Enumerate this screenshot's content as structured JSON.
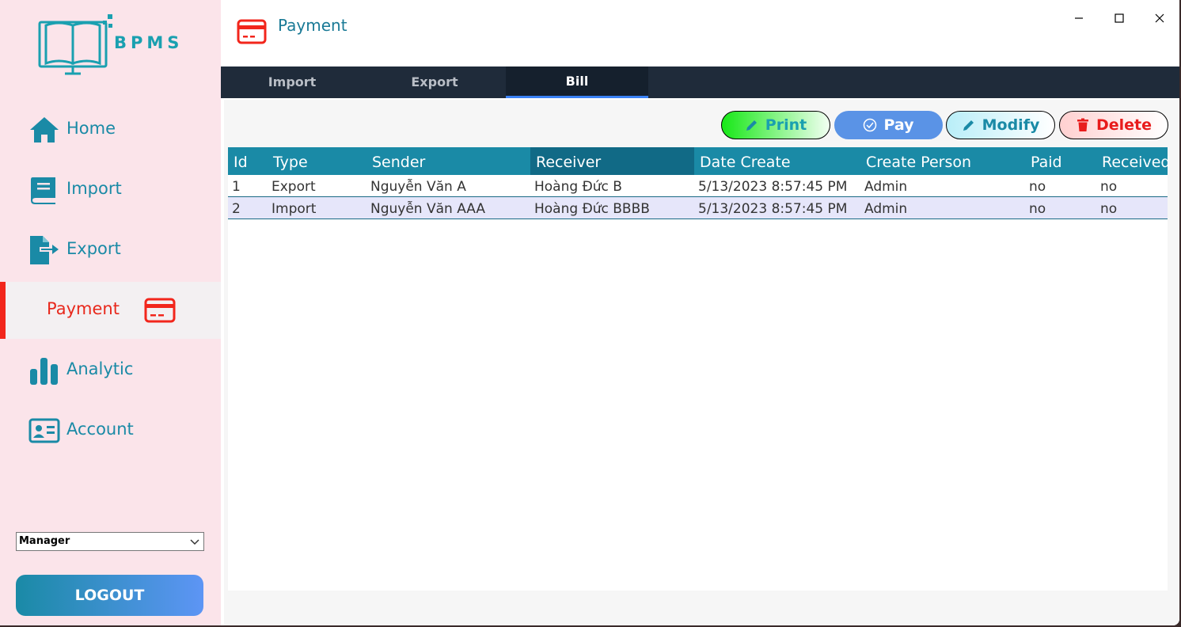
{
  "app": {
    "logo_text": "BPMS"
  },
  "sidebar": {
    "items": [
      {
        "label": "Home",
        "icon": "home-icon"
      },
      {
        "label": "Import",
        "icon": "book-icon"
      },
      {
        "label": "Export",
        "icon": "file-export-icon"
      },
      {
        "label": "Payment",
        "icon": "credit-card-icon",
        "active": true
      },
      {
        "label": "Analytic",
        "icon": "bar-chart-icon"
      },
      {
        "label": "Account",
        "icon": "id-card-icon"
      }
    ],
    "role_select": {
      "value": "Manager"
    },
    "logout_label": "LOGOUT"
  },
  "header": {
    "title": "Payment"
  },
  "tabs": [
    {
      "label": "Import"
    },
    {
      "label": "Export"
    },
    {
      "label": "Bill",
      "active": true
    }
  ],
  "toolbar": {
    "print_label": "Print",
    "pay_label": "Pay",
    "modify_label": "Modify",
    "delete_label": "Delete"
  },
  "table": {
    "columns": [
      "Id",
      "Type",
      "Sender",
      "Receiver",
      "Date Create",
      "Create Person",
      "Paid",
      "Received"
    ],
    "rows": [
      [
        "1",
        "Export",
        "Nguyễn Văn A",
        "Hoàng Đức B",
        "5/13/2023 8:57:45 PM",
        "Admin",
        "no",
        "no"
      ],
      [
        "2",
        "Import",
        "Nguyễn Văn AAA",
        "Hoàng Đức BBBB",
        "5/13/2023 8:57:45 PM",
        "Admin",
        "no",
        "no"
      ]
    ]
  },
  "colors": {
    "accent": "#1a8aa6",
    "active_red": "#e8281c",
    "sidebar_bg": "#fbe4ea",
    "tab_bar": "#1f2b3a",
    "tab_underline": "#3b82f6"
  }
}
